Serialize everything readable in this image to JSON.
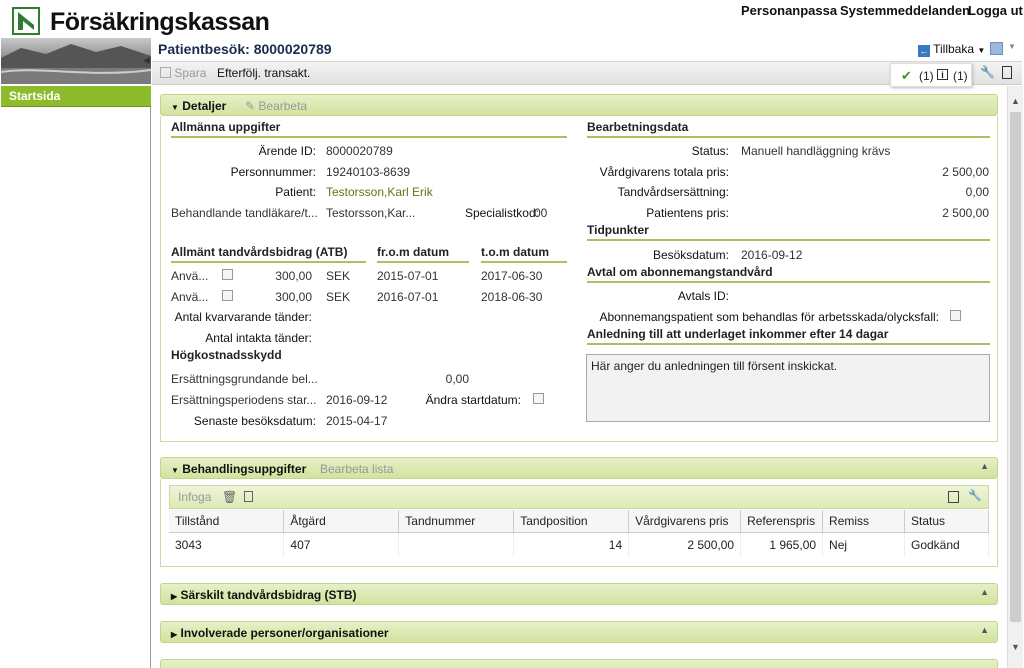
{
  "header": {
    "logo_text": "Försäkringskassan",
    "links": [
      "Personanpassa",
      "Systemmeddelanden",
      "Logga ut"
    ]
  },
  "sidebar": {
    "items": [
      {
        "label": "Startsida",
        "active": true
      }
    ]
  },
  "page": {
    "title": "Patientbesök: 8000020789",
    "back_label": "Tillbaka",
    "toolbar": {
      "save_label": "Spara",
      "follow_label": "Efterfölj. transakt."
    },
    "notifications": {
      "ok": "(1)",
      "info": "(1)"
    }
  },
  "details": {
    "title": "Detaljer",
    "edit_label": "Bearbeta",
    "general": {
      "title": "Allmänna uppgifter",
      "arende_label": "Ärende ID:",
      "arende": "8000020789",
      "pnr_label": "Personnummer:",
      "pnr": "19240103-8639",
      "patient_label": "Patient:",
      "patient": "Testorsson,Karl Erik",
      "dentist_label": "Behandlande tandläkare/t...",
      "dentist": "Testorsson,Kar...",
      "spec_label": "Specialistkod:",
      "spec": "00"
    },
    "atb": {
      "title": "Allmänt tandvårdsbidrag (ATB)",
      "from_header": "fr.o.m datum",
      "tom_header": "t.o.m datum",
      "rows": [
        {
          "label": "Anvä...",
          "amount": "300,00",
          "currency": "SEK",
          "from": "2015-07-01",
          "to": "2017-06-30"
        },
        {
          "label": "Anvä...",
          "amount": "300,00",
          "currency": "SEK",
          "from": "2016-07-01",
          "to": "2018-06-30"
        }
      ],
      "remaining_label": "Antal kvarvarande tänder:",
      "intact_label": "Antal intakta tänder:"
    },
    "hkskydd": {
      "title": "Högkostnadsskydd",
      "basis_label": "Ersättningsgrundande bel...",
      "basis": "0,00",
      "period_label": "Ersättningsperiodens star...",
      "period": "2016-09-12",
      "change_label": "Ändra startdatum:",
      "last_visit_label": "Senaste besöksdatum:",
      "last_visit": "2015-04-17"
    },
    "processing": {
      "title": "Bearbetningsdata",
      "status_label": "Status:",
      "status": "Manuell handläggning krävs",
      "total_label": "Vårdgivarens totala pris:",
      "total": "2 500,00",
      "comp_label": "Tandvårdsersättning:",
      "comp": "0,00",
      "patient_price_label": "Patientens pris:",
      "patient_price": "2 500,00"
    },
    "times": {
      "title": "Tidpunkter",
      "visit_label": "Besöksdatum:",
      "visit": "2016-09-12"
    },
    "subscription": {
      "title": "Avtal om abonnemangstandvård",
      "avtal_label": "Avtals ID:",
      "injury_label": "Abonnemangspatient som behandlas för arbetsskada/olycksfall:"
    },
    "late": {
      "title": "Anledning till att underlaget inkommer efter 14 dagar",
      "text": "Här anger du anledningen till försent inskickat."
    }
  },
  "treatments": {
    "title": "Behandlingsuppgifter",
    "edit_list_label": "Bearbeta lista",
    "insert_label": "Infoga",
    "columns": [
      "Tillstånd",
      "Åtgärd",
      "Tandnummer",
      "Tandposition",
      "Vårdgivarens pris",
      "Referenspris",
      "Remiss",
      "Status"
    ],
    "rows": [
      [
        "3043",
        "407",
        "",
        "14",
        "2 500,00",
        "1 965,00",
        "Nej",
        "Godkänd"
      ]
    ]
  },
  "collapsed_panels": [
    {
      "title": "Särskilt tandvårdsbidrag (STB)"
    },
    {
      "title": "Involverade personer/organisationer"
    }
  ]
}
